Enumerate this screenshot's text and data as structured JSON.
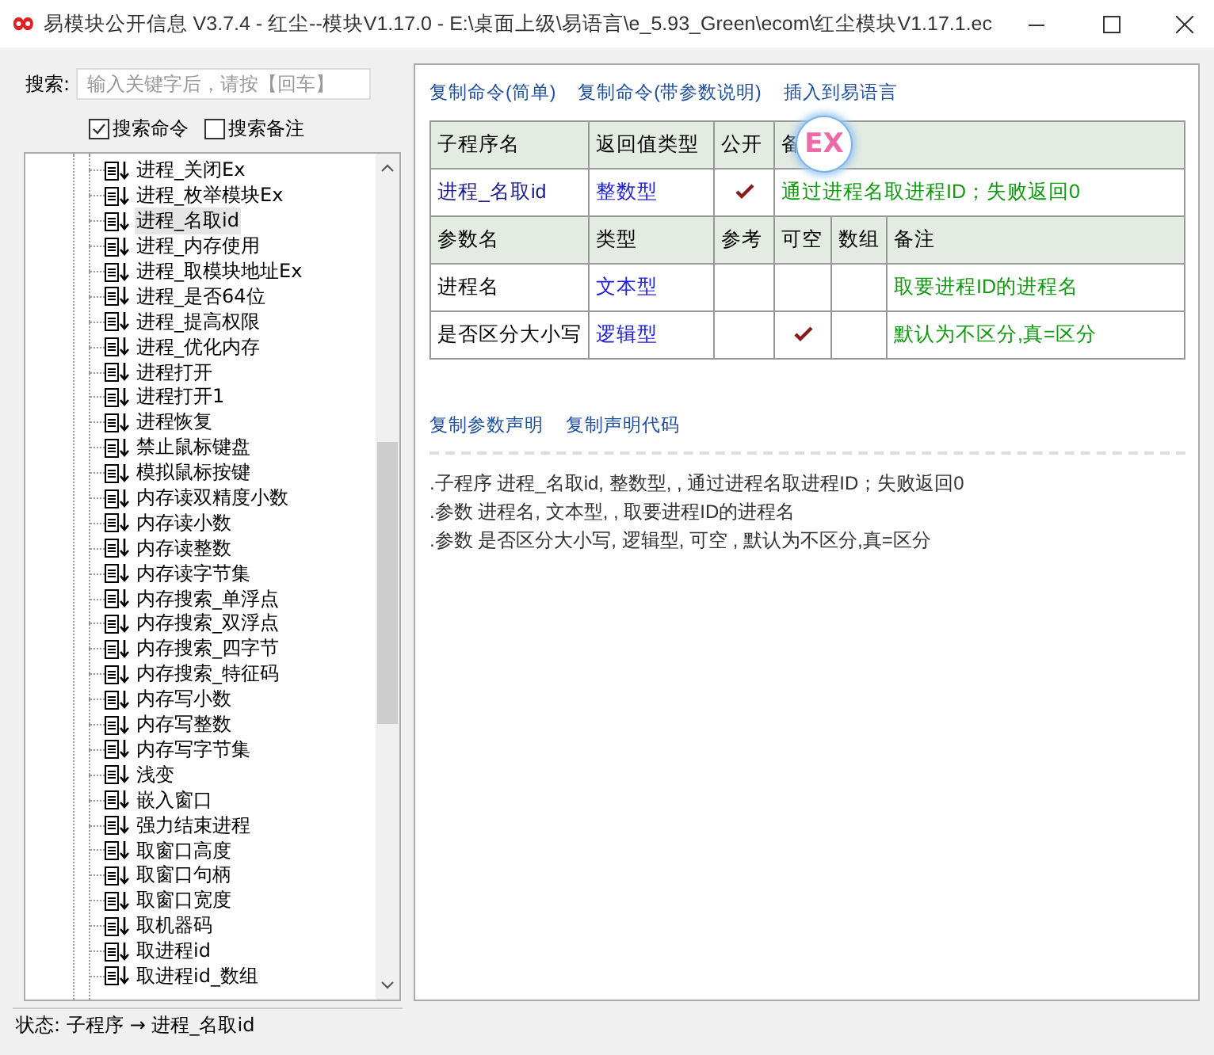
{
  "window": {
    "title": "易模块公开信息 V3.7.4 - 红尘--模块V1.17.0 - E:\\桌面上级\\易语言\\e_5.93_Green\\ecom\\红尘模块V1.17.1.ec"
  },
  "search": {
    "label": "搜索:",
    "placeholder": "输入关键字后，请按【回车】"
  },
  "filters": [
    {
      "label": "搜索命令",
      "checked": true
    },
    {
      "label": "搜索备注",
      "checked": false
    }
  ],
  "tree": {
    "items": [
      {
        "label": "进程_关闭Ex",
        "selected": false
      },
      {
        "label": "进程_枚举模块Ex",
        "selected": false
      },
      {
        "label": "进程_名取id",
        "selected": true
      },
      {
        "label": "进程_内存使用",
        "selected": false
      },
      {
        "label": "进程_取模块地址Ex",
        "selected": false
      },
      {
        "label": "进程_是否64位",
        "selected": false
      },
      {
        "label": "进程_提高权限",
        "selected": false
      },
      {
        "label": "进程_优化内存",
        "selected": false
      },
      {
        "label": "进程打开",
        "selected": false
      },
      {
        "label": "进程打开1",
        "selected": false
      },
      {
        "label": "进程恢复",
        "selected": false
      },
      {
        "label": "禁止鼠标键盘",
        "selected": false
      },
      {
        "label": "模拟鼠标按键",
        "selected": false
      },
      {
        "label": "内存读双精度小数",
        "selected": false
      },
      {
        "label": "内存读小数",
        "selected": false
      },
      {
        "label": "内存读整数",
        "selected": false
      },
      {
        "label": "内存读字节集",
        "selected": false
      },
      {
        "label": "内存搜索_单浮点",
        "selected": false
      },
      {
        "label": "内存搜索_双浮点",
        "selected": false
      },
      {
        "label": "内存搜索_四字节",
        "selected": false
      },
      {
        "label": "内存搜索_特征码",
        "selected": false
      },
      {
        "label": "内存写小数",
        "selected": false
      },
      {
        "label": "内存写整数",
        "selected": false
      },
      {
        "label": "内存写字节集",
        "selected": false
      },
      {
        "label": "浅变",
        "selected": false
      },
      {
        "label": "嵌入窗口",
        "selected": false
      },
      {
        "label": "强力结束进程",
        "selected": false
      },
      {
        "label": "取窗口高度",
        "selected": false
      },
      {
        "label": "取窗口句柄",
        "selected": false
      },
      {
        "label": "取窗口宽度",
        "selected": false
      },
      {
        "label": "取机器码",
        "selected": false
      },
      {
        "label": "取进程id",
        "selected": false
      },
      {
        "label": "取进程id_数组",
        "selected": false
      }
    ]
  },
  "status_bar": {
    "label": "状态:",
    "text": "子程序 → 进程_名取id"
  },
  "top_links": [
    "复制命令(简单)",
    "复制命令(带参数说明)",
    "插入到易语言"
  ],
  "sub_table": {
    "headers": [
      "子程序名",
      "返回值类型",
      "公开",
      "备"
    ],
    "name": "进程_名取id",
    "return_type": "整数型",
    "public": true,
    "note": "通过进程名取进程ID；失败返回0"
  },
  "overlay_badge": "EX",
  "param_table": {
    "headers": [
      "参数名",
      "类型",
      "参考",
      "可空",
      "数组",
      "备注"
    ],
    "rows": [
      {
        "name": "进程名",
        "type": "文本型",
        "nullable": false,
        "note": "取要进程ID的进程名"
      },
      {
        "name": "是否区分大小写",
        "type": "逻辑型",
        "nullable": true,
        "note": "默认为不区分,真=区分"
      }
    ]
  },
  "bottom_links": [
    "复制参数声明",
    "复制声明代码"
  ],
  "code_lines": [
    ".子程序 进程_名取id, 整数型, , 通过进程名取进程ID；失败返回0",
    ".参数 进程名, 文本型, , 取要进程ID的进程名",
    ".参数 是否区分大小写, 逻辑型, 可空 , 默认为不区分,真=区分"
  ]
}
